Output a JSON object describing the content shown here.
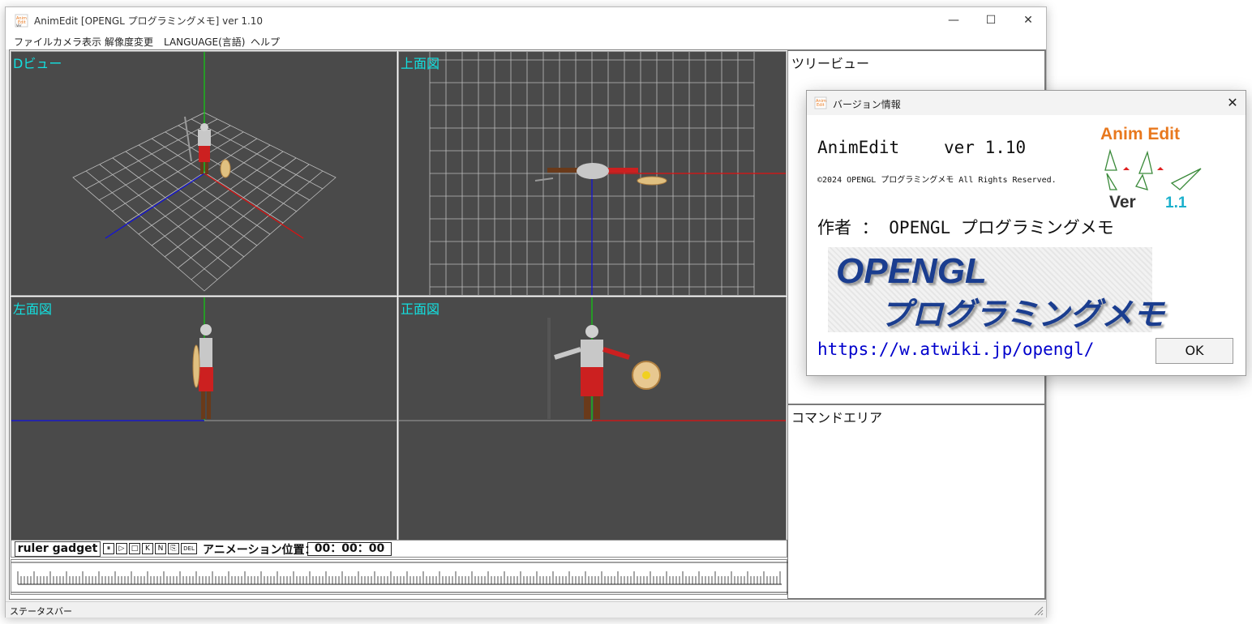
{
  "window": {
    "title": "AnimEdit [OPENGL プログラミングメモ] ver 1.10",
    "minimize": "—",
    "maximize": "☐",
    "close": "✕"
  },
  "menu": [
    "ファイル",
    "カメラ表示",
    "解像度変更",
    "LANGUAGE(言語)",
    "ヘルプ"
  ],
  "viewports": {
    "view3d": "Dビュー",
    "top": "上面図",
    "left": "左面図",
    "front": "正面図"
  },
  "panels": {
    "tree": "ツリービュー",
    "command": "コマンドエリア"
  },
  "ruler": {
    "tab": "ruler gadget",
    "controls": [
      "⏸",
      "▷",
      "□",
      "K",
      "N",
      "⎘",
      "DEL"
    ],
    "anim_label": "アニメーション位置：",
    "anim_time": "00：00：00"
  },
  "status": "ステータスバー",
  "dialog": {
    "title": "バージョン情報",
    "close": "✕",
    "app_name": "AnimEdit",
    "version": "ver 1.10",
    "copyright": "©2024 OPENGL プログラミングメモ All Rights Reserved.",
    "author": "作者 ： OPENGL プログラミングメモ",
    "banner_line1": "OPENGL",
    "banner_line2": "プログラミングメモ",
    "link": "https://w.atwiki.jp/opengl/",
    "ok": "OK",
    "logo_title": "Anim Edit",
    "logo_ver": "Ver",
    "logo_num": "1.1"
  },
  "colors": {
    "viewport_bg": "#4a4a4a",
    "label_cyan": "#12e0e0",
    "axis_x": "#e01010",
    "axis_y": "#10d010",
    "axis_z": "#1010e0",
    "logo_orange": "#e8781e"
  }
}
